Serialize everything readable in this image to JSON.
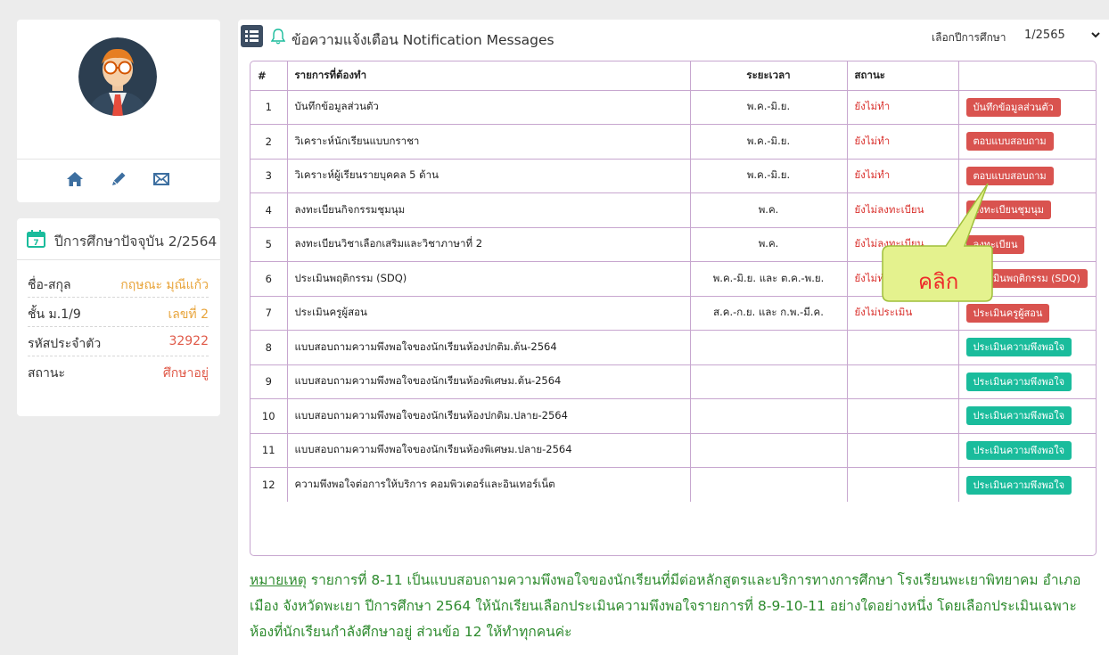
{
  "profile": {
    "avatar_icon": "user-avatar-glasses",
    "nav_icons": [
      "home-icon",
      "pencil-icon",
      "envelope-icon"
    ]
  },
  "year_card": {
    "title": "ปีการศึกษาปัจจุบัน 2/2564",
    "rows": [
      {
        "label": "ชื่อ-สกุล",
        "value": "กฤษณะ มุณีแก้ว"
      },
      {
        "label": "ชั้น ม.1/9",
        "value": "เลขที่ 2"
      },
      {
        "label": "รหัสประจำตัว",
        "value": "32922"
      },
      {
        "label": "สถานะ",
        "value": "ศึกษาอยู่"
      }
    ]
  },
  "main": {
    "title": "ข้อความแจ้งเตือน Notification Messages",
    "year_select_label": "เลือกปีการศึกษา",
    "year_select_value": "1/2565",
    "columns": [
      "#",
      "รายการที่ต้องทำ",
      "ระยะเวลา",
      "สถานะ",
      ""
    ],
    "rows": [
      {
        "num": "1",
        "task": "บันทึกข้อมูลส่วนตัว",
        "period": "พ.ค.-มิ.ย.",
        "status": "ยังไม่ทำ",
        "action": "บันทึกข้อมูลส่วนตัว",
        "action_color": "red"
      },
      {
        "num": "2",
        "task": "วิเคราะห์นักเรียนแบบกราชา",
        "period": "พ.ค.-มิ.ย.",
        "status": "ยังไม่ทำ",
        "action": "ตอบแบบสอบถาม",
        "action_color": "red"
      },
      {
        "num": "3",
        "task": "วิเคราะห์ผู้เรียนรายบุคคล 5 ด้าน",
        "period": "พ.ค.-มิ.ย.",
        "status": "ยังไม่ทำ",
        "action": "ตอบแบบสอบถาม",
        "action_color": "red"
      },
      {
        "num": "4",
        "task": "ลงทะเบียนกิจกรรมชุมนุม",
        "period": "พ.ค.",
        "status": "ยังไม่ลงทะเบียน",
        "action": "ลงทะเบียนชุมนุม",
        "action_color": "red"
      },
      {
        "num": "5",
        "task": "ลงทะเบียนวิชาเลือกเสริมและวิชาภาษาที่ 2",
        "period": "พ.ค.",
        "status": "ยังไม่ลงทะเบียน",
        "action": "ลงทะเบียน",
        "action_color": "red"
      },
      {
        "num": "6",
        "task": "ประเมินพฤติกรรม (SDQ)",
        "period": "พ.ค.-มิ.ย. และ ต.ค.-พ.ย.",
        "status": "ยังไม่ทำ",
        "action": "ประเมินพฤติกรรม (SDQ)",
        "action_color": "red"
      },
      {
        "num": "7",
        "task": "ประเมินครูผู้สอน",
        "period": "ส.ค.-ก.ย. และ ก.พ.-มี.ค.",
        "status": "ยังไม่ประเมิน",
        "action": "ประเมินครูผู้สอน",
        "action_color": "red"
      },
      {
        "num": "8",
        "task": "แบบสอบถามความพึงพอใจของนักเรียนห้องปกติม.ต้น-2564",
        "period": "",
        "status": "",
        "action": "ประเมินความพึงพอใจ",
        "action_color": "teal"
      },
      {
        "num": "9",
        "task": "แบบสอบถามความพึงพอใจของนักเรียนห้องพิเศษม.ต้น-2564",
        "period": "",
        "status": "",
        "action": "ประเมินความพึงพอใจ",
        "action_color": "teal"
      },
      {
        "num": "10",
        "task": "แบบสอบถามความพึงพอใจของนักเรียนห้องปกติม.ปลาย-2564",
        "period": "",
        "status": "",
        "action": "ประเมินความพึงพอใจ",
        "action_color": "teal"
      },
      {
        "num": "11",
        "task": "แบบสอบถามความพึงพอใจของนักเรียนห้องพิเศษม.ปลาย-2564",
        "period": "",
        "status": "",
        "action": "ประเมินความพึงพอใจ",
        "action_color": "teal"
      },
      {
        "num": "12",
        "task": "ความพึงพอใจต่อการให้บริการ คอมพิวเตอร์และอินเทอร์เน็ต",
        "period": "",
        "status": "",
        "action": "ประเมินความพึงพอใจ",
        "action_color": "teal"
      }
    ],
    "note_label": "หมายเหตุ",
    "note_text": " รายการที่ 8-11 เป็นแบบสอบถามความพึงพอใจของนักเรียนที่มีต่อหลักสูตรและบริการทางการศึกษา โรงเรียนพะเยาพิทยาคม อำเภอเมือง จังหวัดพะเยา ปีการศึกษา 2564 ให้นักเรียนเลือกประเมินความพึงพอใจรายการที่ 8-9-10-11 อย่างใดอย่างหนึ่ง โดยเลือกประเมินเฉพาะห้องที่นักเรียนกำลังศึกษาอยู่ ส่วนข้อ 12 ให้ทำทุกคนค่ะ"
  },
  "callout": {
    "text": "คลิก"
  },
  "colors": {
    "red_button": "#d9534f",
    "teal_button": "#1abc9c",
    "status_red": "#d9302c",
    "note_green": "#2e8b2e",
    "value_orange": "#e8a43a"
  }
}
